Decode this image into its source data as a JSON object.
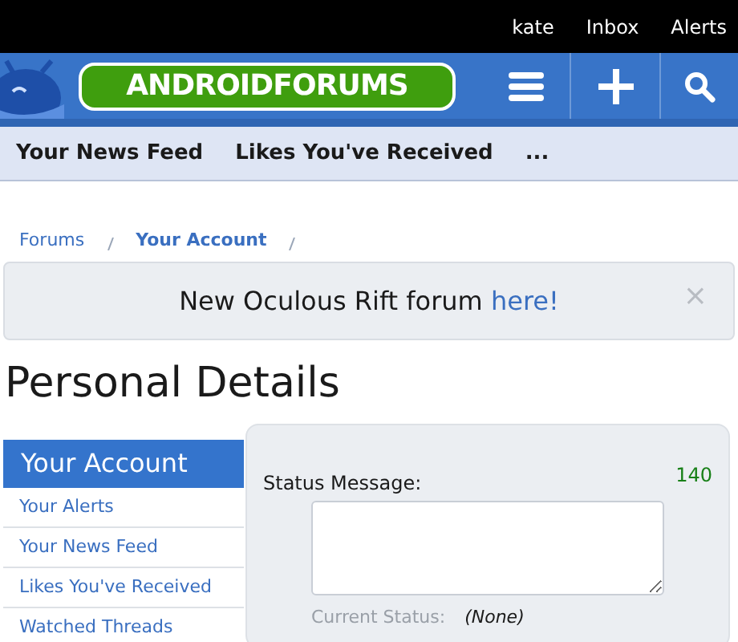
{
  "top_bar": {
    "links": [
      "kate",
      "Inbox",
      "Alerts"
    ]
  },
  "header": {
    "logo_text": "ANDROIDFORUMS"
  },
  "nav_tabs": [
    "Your News Feed",
    "Likes You've Received",
    "..."
  ],
  "breadcrumb": [
    "Forums",
    "Your Account"
  ],
  "notice": {
    "text": "New Oculous Rift forum ",
    "link": "here!",
    "close": "×"
  },
  "page_title": "Personal Details",
  "sidebar": {
    "title": "Your Account",
    "items": [
      "Your Alerts",
      "Your News Feed",
      "Likes You've Received",
      "Watched Threads"
    ]
  },
  "form": {
    "status_label": "Status Message:",
    "counter": "140",
    "current_status_label": "Current Status:",
    "current_status_value": "(None)"
  }
}
